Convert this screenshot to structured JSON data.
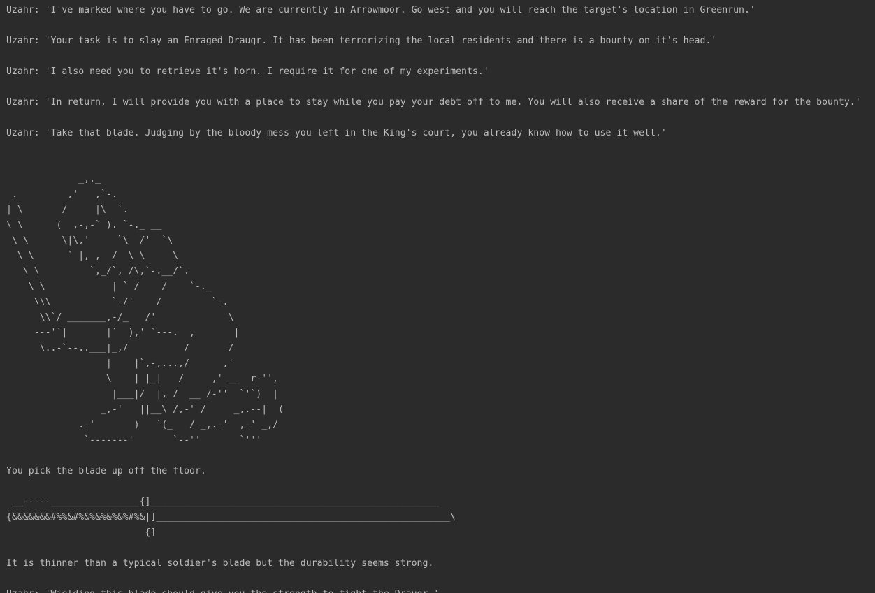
{
  "console": {
    "lines_top": [
      "Uzahr: 'I've marked where you have to go. We are currently in Arrowmoor. Go west and you will reach the target's location in Greenrun.'",
      "Uzahr: 'Your task is to slay an Enraged Draugr. It has been terrorizing the local residents and there is a bounty on it's head.'",
      "Uzahr: 'I also need you to retrieve it's horn. I require it for one of my experiments.'",
      "Uzahr: 'In return, I will provide you with a place to stay while you pay your debt off to me. You will also receive a share of the reward for the bounty.'",
      "Uzahr: 'Take that blade. Judging by the bloody mess you left in the King's court, you already know how to use it well.'"
    ],
    "draugr_art": "             _,._\n .         ,'   ,`-.\n| \\       /     |\\  `.\n\\ \\      (  ,-,-` ). `-._ __\n \\ \\      \\|\\,'     `\\  /'  `\\\n  \\ \\      ` |, ,  /  \\ \\     \\\n   \\ \\         `,_/`, /\\,`-.__/`.\n    \\ \\            | ` /    /    `-._\n     \\\\\\           `-/'    /         `-.\n      \\\\`/ _______,-/_   /'             \\\n     ---'`|       |`  ),' `---.  ,       |\n      \\..-`--..___|_,/          /       /\n                  |    |`,-,...,/      ,'\n                  \\    | |_|   /     ,' __  r-'',\n                   |___|/  |, /  __ /-''  `'`)  |\n                 _,-'   ||__\\ /,-' /     _,.--|  (\n             .-'       )   `(_   / _,.-'  ,-' _,/\n              `-------'       `--''       `'''",
    "pickup_line": "You pick the blade up off the floor.",
    "blade_art": " __-----________________{]____________________________________________________\n{&&&&&&&#%%&#%&%&%&%&%#%&|]_____________________________________________________\\\n                         {]",
    "lines_bottom": [
      "It is thinner than a typical soldier's blade but the durability seems strong.",
      "Uzahr: 'Wielding this blade should give you the strength to fight the Draugr.'"
    ]
  }
}
